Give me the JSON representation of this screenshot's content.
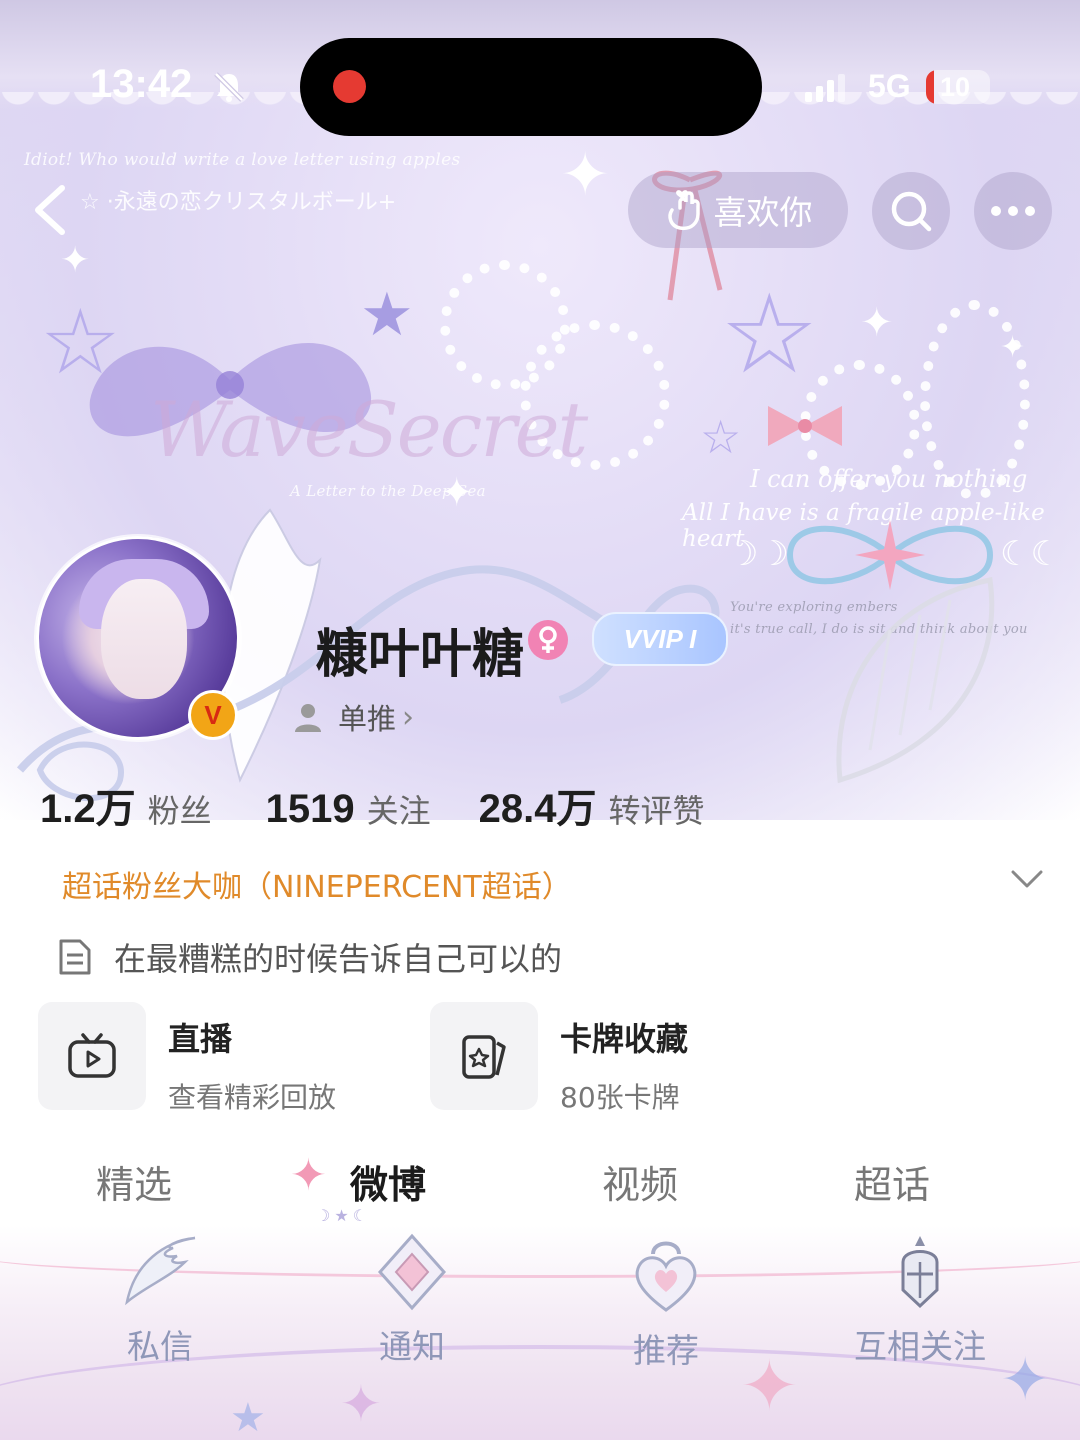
{
  "status_bar": {
    "time": "13:42",
    "network": "5G",
    "battery": "10"
  },
  "banner": {
    "script_line": "Idiot! Who would write a love letter using apples",
    "jp_line": "☆ ·永遠の恋クリスタルボール+",
    "logo_text": "WaveSecret",
    "logo_sub": "A Letter to the Deep Sea",
    "quote_line1": "I can offer you nothing",
    "quote_line2": "All I have is a fragile apple-like heart",
    "small_line1": "You're exploring embers",
    "small_line2": "it's true call, I do is sit and think about you"
  },
  "nav": {
    "like_label": "喜欢你"
  },
  "profile": {
    "name": "糠叶叶糖",
    "vip_label": "VVIP I",
    "v_badge": "V",
    "subtag": "单推"
  },
  "stats": [
    {
      "value": "1.2万",
      "label": "粉丝"
    },
    {
      "value": "1519",
      "label": "关注"
    },
    {
      "value": "28.4万",
      "label": "转评赞"
    }
  ],
  "supertopic": "超话粉丝大咖（NINEPERCENT超话）",
  "bio": "在最糟糕的时候告诉自己可以的",
  "cards": [
    {
      "title": "直播",
      "subtitle": "查看精彩回放",
      "icon": "tv-play-icon"
    },
    {
      "title": "卡牌收藏",
      "subtitle": "80张卡牌",
      "icon": "card-icon"
    }
  ],
  "tabs": [
    "精选",
    "微博",
    "视频",
    "超话"
  ],
  "active_tab": "微博",
  "bottom_tabs": [
    "私信",
    "通知",
    "推荐",
    "互相关注"
  ],
  "colors": {
    "accent_orange": "#e08a2a",
    "record_red": "#e53a32",
    "gender_pink": "#f183b4"
  }
}
